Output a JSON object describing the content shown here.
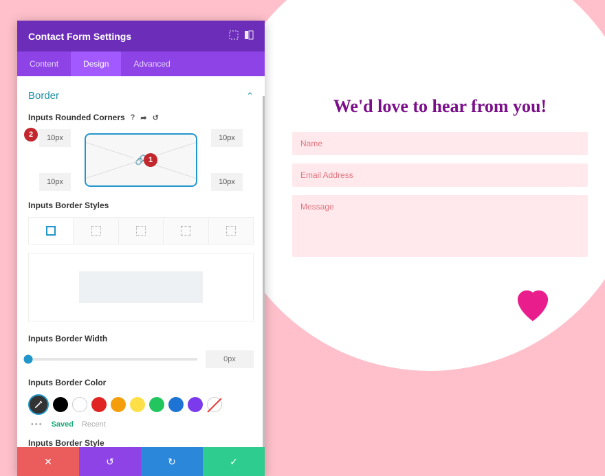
{
  "panel": {
    "title": "Contact Form Settings"
  },
  "tabs": {
    "content": "Content",
    "design": "Design",
    "advanced": "Advanced"
  },
  "section": {
    "border": "Border"
  },
  "options": {
    "rounded_label": "Inputs Rounded Corners",
    "corners": {
      "tl": "10px",
      "tr": "10px",
      "bl": "10px",
      "br": "10px"
    },
    "styles_label": "Inputs Border Styles",
    "width_label": "Inputs Border Width",
    "width_value": "0px",
    "color_label": "Inputs Border Color",
    "style_label": "Inputs Border Style"
  },
  "badges": {
    "one": "1",
    "two": "2"
  },
  "swatches": {
    "colors": [
      "#000000",
      "#ffffff",
      "#e02424",
      "#f59e0b",
      "#fde047",
      "#22c55e",
      "#1d74d4",
      "#7c3aed"
    ]
  },
  "saved": {
    "saved": "Saved",
    "recent": "Recent"
  },
  "preview": {
    "title": "We'd love to hear from you!",
    "name": "Name",
    "email": "Email Address",
    "message": "Message"
  }
}
